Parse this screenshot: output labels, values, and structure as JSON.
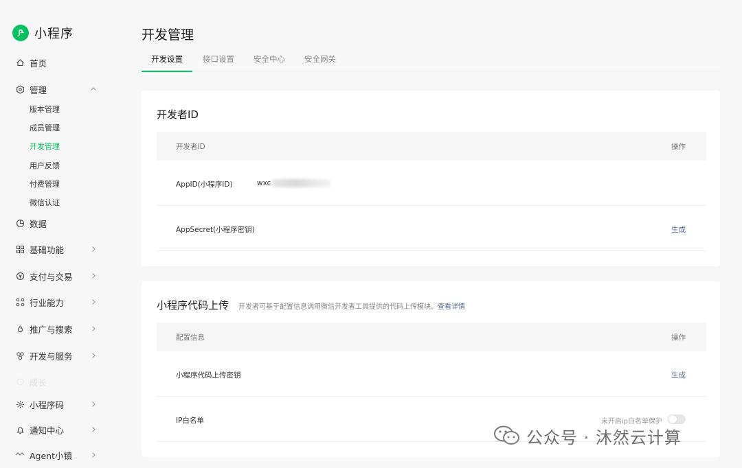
{
  "brand": {
    "name": "小程序",
    "logo_color": "#07c160"
  },
  "sidebar": {
    "items": [
      {
        "label": "首页",
        "icon": "home-icon"
      },
      {
        "label": "管理",
        "icon": "settings-icon"
      },
      {
        "label": "数据",
        "icon": "pie-chart-icon"
      },
      {
        "label": "基础功能",
        "icon": "grid-icon"
      },
      {
        "label": "支付与交易",
        "icon": "payment-icon"
      },
      {
        "label": "行业能力",
        "icon": "nodes-icon"
      },
      {
        "label": "推广与搜索",
        "icon": "flame-icon"
      },
      {
        "label": "开发与服务",
        "icon": "cluster-icon"
      },
      {
        "label": "成长",
        "icon": "growth-icon"
      },
      {
        "label": "小程序码",
        "icon": "sun-icon"
      },
      {
        "label": "通知中心",
        "icon": "bell-icon"
      },
      {
        "label": "Agent小镇",
        "icon": "agent-icon"
      }
    ],
    "sub_items": [
      "版本管理",
      "成员管理",
      "开发管理",
      "用户反馈",
      "付费管理",
      "微信认证"
    ],
    "active_sub": "开发管理"
  },
  "main": {
    "title": "开发管理",
    "tabs": [
      "开发设置",
      "接口设置",
      "安全中心",
      "安全网关"
    ],
    "active_tab": "开发设置"
  },
  "developer_id": {
    "title": "开发者ID",
    "headers": [
      "开发者ID",
      "操作"
    ],
    "rows": [
      {
        "label": "AppID(小程序ID)",
        "value": "wxc",
        "action": ""
      },
      {
        "label": "AppSecret(小程序密钥)",
        "value": "",
        "action": "生成"
      }
    ]
  },
  "upload": {
    "title": "小程序代码上传",
    "desc": "开发者可基于配置信息调用微信开发者工具提供的代码上传模块。",
    "desc_link": "查看详情",
    "headers": [
      "配置信息",
      "操作"
    ],
    "rows": [
      {
        "label": "小程序代码上传密钥",
        "action": "生成"
      },
      {
        "label": "IP白名单",
        "status": "未开启ip白名单保护"
      }
    ],
    "ip_whitelist_enabled": false
  },
  "watermark": {
    "text": "公众号 · 沐然云计算"
  },
  "colors": {
    "accent": "#07c160",
    "link": "#576b95"
  }
}
